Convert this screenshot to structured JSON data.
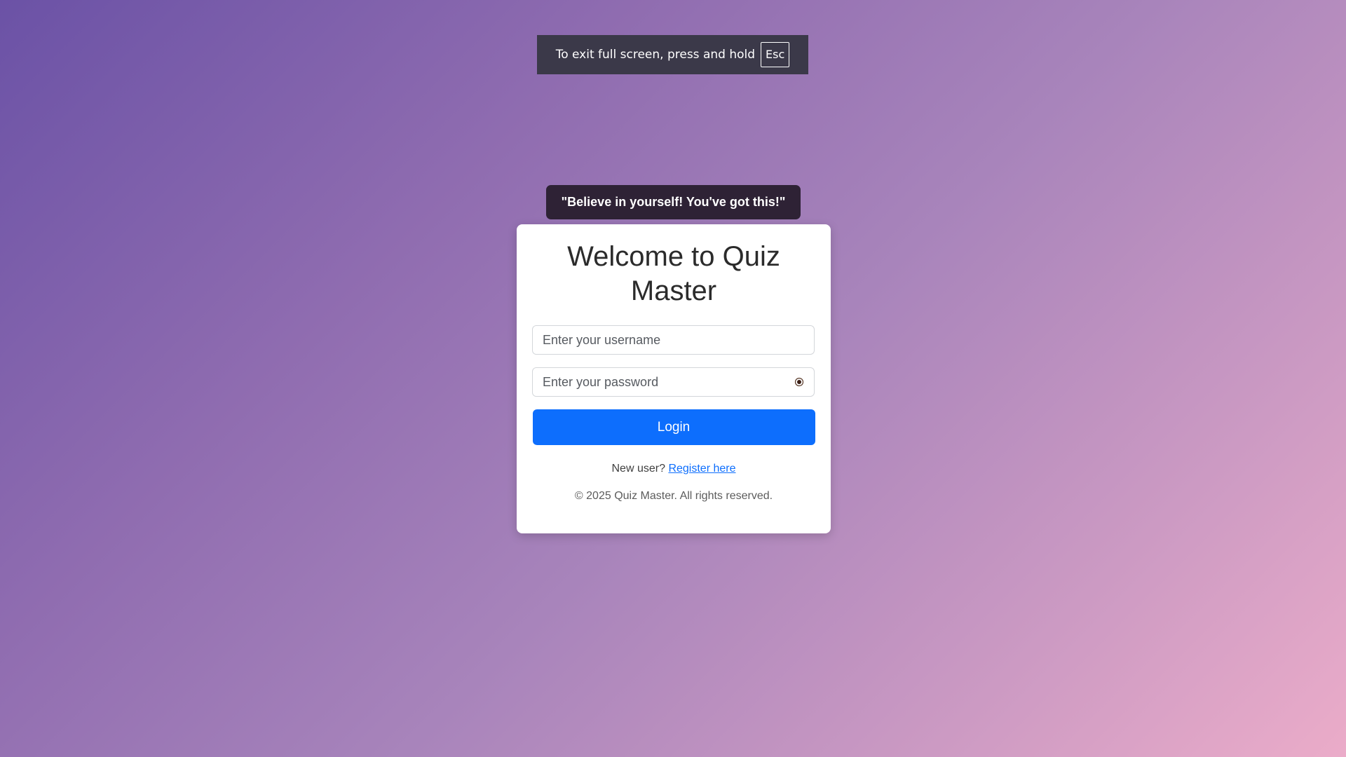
{
  "fullscreen_notice": {
    "text": "To exit full screen, press and hold",
    "key": "Esc"
  },
  "quote": "\"Believe in yourself! You've got this!\"",
  "login_card": {
    "title": "Welcome to Quiz Master",
    "username_placeholder": "Enter your username",
    "password_placeholder": "Enter your password",
    "password_toggle_icon": "eye-icon",
    "login_label": "Login",
    "new_user_text": "New user?",
    "register_link": "Register here",
    "copyright": "© 2025 Quiz Master. All rights reserved."
  },
  "colors": {
    "primary": "#0d6efd",
    "quote_bg": "#2e2235",
    "notice_bg": "#3b3949",
    "gradient_start": "#6b52a6",
    "gradient_end": "#ebacc9"
  }
}
